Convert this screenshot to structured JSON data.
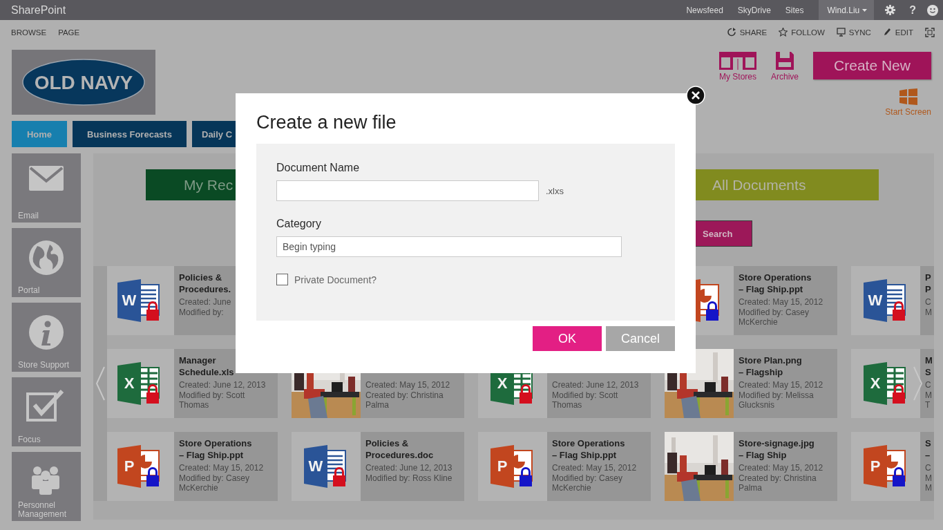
{
  "top_bar": {
    "brand": "SharePoint",
    "links": [
      "Newsfeed",
      "SkyDrive",
      "Sites"
    ],
    "user": "Wind.Liu",
    "help": "?"
  },
  "ribbon": {
    "tabs": [
      "BROWSE",
      "PAGE"
    ],
    "actions": [
      {
        "kind": "share",
        "label": "SHARE"
      },
      {
        "kind": "follow",
        "label": "FOLLOW"
      },
      {
        "kind": "sync",
        "label": "SYNC"
      },
      {
        "kind": "edit",
        "label": "EDIT"
      }
    ]
  },
  "logo": {
    "text": "OLD NAVY"
  },
  "quick_links": [
    {
      "kind": "store",
      "label": "My Stores"
    },
    {
      "kind": "archive",
      "label": "Archive"
    }
  ],
  "create_button": "Create New",
  "start_screen": "Start Screen",
  "nav_tabs": [
    {
      "label": "Home",
      "selected": true
    },
    {
      "label": "Business Forecasts",
      "selected": false
    },
    {
      "label": "Daily C",
      "selected": false
    }
  ],
  "side_tiles": [
    {
      "kind": "email",
      "label": "Email"
    },
    {
      "kind": "portal",
      "label": "Portal"
    },
    {
      "kind": "support",
      "label": "Store Support"
    },
    {
      "kind": "focus",
      "label": "Focus"
    },
    {
      "kind": "people",
      "label": "Personnel Management"
    }
  ],
  "banners": [
    {
      "label": "My Rec",
      "color": "#0a4a24"
    },
    {
      "label": "All Documents",
      "color": "#818b1f"
    }
  ],
  "search_button": "Search",
  "file_rows": [
    [
      {
        "kind": "word",
        "letter": "W",
        "color": "#d40f1e",
        "title": [
          "Policies &",
          "Procedures."
        ],
        "details": [
          "Created: June",
          "Modified by:"
        ]
      },
      null,
      null,
      {
        "kind": "ppt",
        "color": "#1515c8",
        "title": [
          "Store Operations",
          "– Flag Ship.ppt"
        ],
        "details": [
          "Created: May 15, 2012",
          "Modified by: Casey",
          "McKerchie"
        ]
      },
      {
        "kind": "word",
        "letter": "W",
        "color": "#d40f1e",
        "title": [
          "P",
          "P"
        ],
        "details": [
          "C",
          "M"
        ]
      }
    ],
    [
      {
        "kind": "excel",
        "letter": "X",
        "color": "#d40f1e",
        "title": [
          "Manager",
          "Schedule.xls"
        ],
        "details": [
          "Created: June 12, 2013",
          "Modified by: Scott",
          "Thomas"
        ]
      },
      {
        "kind": "picture",
        "details": [
          "Created: May 15, 2012",
          "Created by: Christina",
          "Palma"
        ]
      },
      {
        "kind": "excel",
        "letter": "X",
        "color": "#d40f1e",
        "details": [
          "Created: June 12, 2013",
          "Modified by: Scott",
          "Thomas"
        ]
      },
      {
        "kind": "picture",
        "title": [
          "Store Plan.png",
          "– Flagship"
        ],
        "details": [
          "Created: May 15, 2012",
          "Modified by: Melissa",
          "Glucksnis"
        ]
      },
      {
        "kind": "excel",
        "letter": "X",
        "color": "#d40f1e",
        "title": [
          "M",
          "S"
        ],
        "details": [
          "C",
          "M",
          "T"
        ]
      }
    ],
    [
      {
        "kind": "ppt",
        "letter": "P",
        "color": "#1515c8",
        "title": [
          "Store Operations",
          "– Flag Ship.ppt"
        ],
        "details": [
          "Created: May 15, 2012",
          "Modified by: Casey",
          "McKerchie"
        ]
      },
      {
        "kind": "word",
        "letter": "W",
        "color": "#d40f1e",
        "title": [
          "Policies &",
          "Procedures.doc"
        ],
        "details": [
          "Created: June 12, 2013",
          "Modified by: Ross Kline"
        ]
      },
      {
        "kind": "ppt",
        "letter": "P",
        "color": "#1515c8",
        "title": [
          "Store Operations",
          "– Flag Ship.ppt"
        ],
        "details": [
          "Created: May 15, 2012",
          "Modified by: Casey",
          "McKerchie"
        ]
      },
      {
        "kind": "picture",
        "title": [
          "Store-signage.jpg",
          "– Flag Ship"
        ],
        "details": [
          "Created: May 15, 2012",
          "Created by: Christina",
          "Palma"
        ]
      },
      {
        "kind": "ppt",
        "letter": "P",
        "color": "#1515c8",
        "title": [
          "S",
          "–"
        ],
        "details": [
          "C",
          "M",
          "M"
        ]
      }
    ]
  ],
  "dialog": {
    "title": "Create a new file",
    "fields": [
      {
        "label": "Document Name",
        "suffix": ".xlxs"
      },
      {
        "label": "Category",
        "placeholder": "Begin typing"
      }
    ],
    "private": {
      "label": "Private Document?",
      "checked": false
    },
    "buttons": [
      {
        "kind": "primary",
        "label": "OK"
      },
      {
        "kind": "secondary",
        "label": "Cancel"
      }
    ]
  }
}
